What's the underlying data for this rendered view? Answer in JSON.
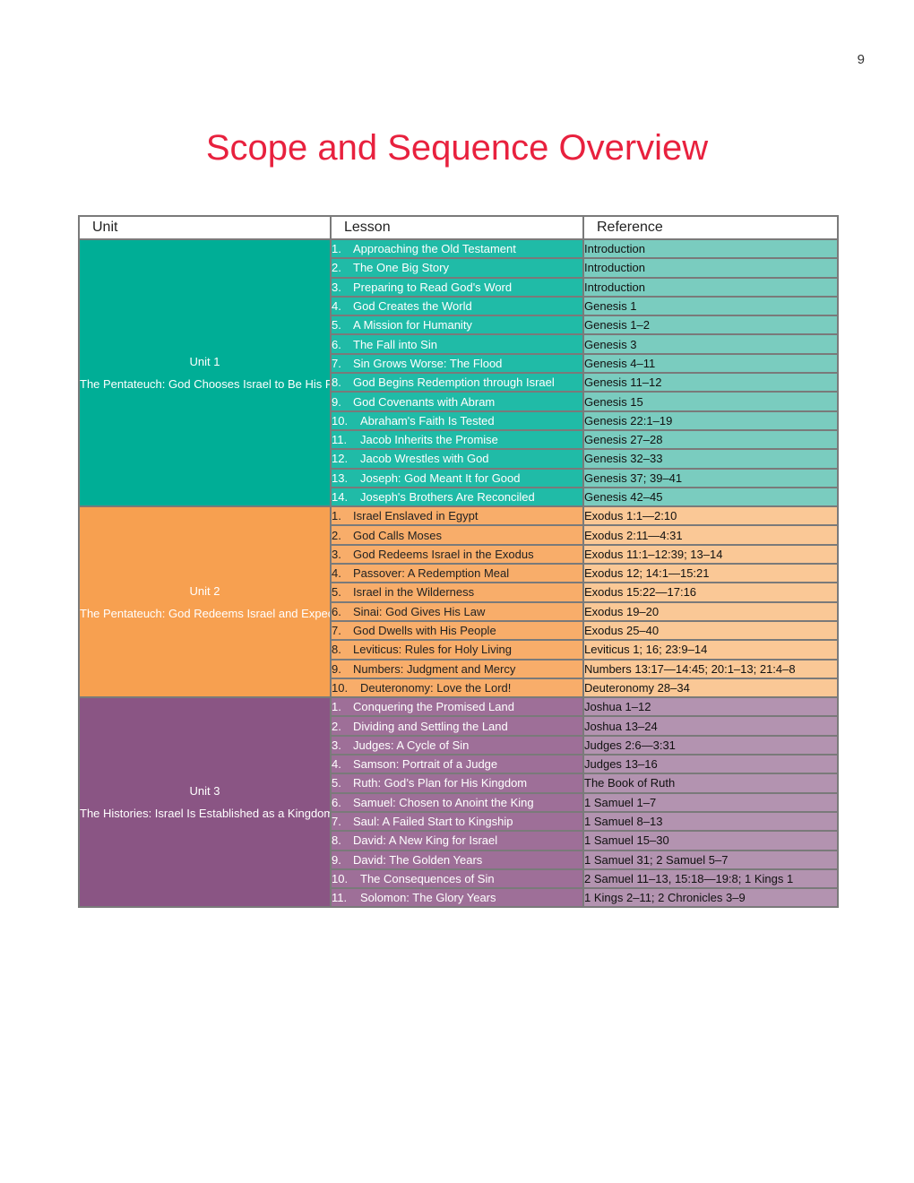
{
  "page_number": "9",
  "title": "Scope and Sequence Overview",
  "colors": {
    "title": "#e8213e",
    "unit1": {
      "unit": "#00ae96",
      "lesson": "#20bba7",
      "reference": "#7accbf"
    },
    "unit2": {
      "unit": "#f7a050",
      "lesson": "#f8ad6a",
      "reference": "#fac896"
    },
    "unit3": {
      "unit": "#8a5584",
      "lesson": "#9e6f98",
      "reference": "#b393b0"
    }
  },
  "table": {
    "headers": {
      "unit": "Unit",
      "lesson": "Lesson",
      "reference": "Reference"
    },
    "units": [
      {
        "label": "Unit 1",
        "name": "The Pentateuch: God Chooses Israel to Be His Redeemed People",
        "lessons": [
          {
            "num": "1.",
            "title": "Approaching the Old Testament",
            "reference": "Introduction"
          },
          {
            "num": "2.",
            "title": "The One Big Story",
            "reference": "Introduction"
          },
          {
            "num": "3.",
            "title": "Preparing to Read God's Word",
            "reference": "Introduction"
          },
          {
            "num": "4.",
            "title": "God Creates the World",
            "reference": "Genesis 1"
          },
          {
            "num": "5.",
            "title": "A Mission for Humanity",
            "reference": "Genesis 1–2"
          },
          {
            "num": "6.",
            "title": "The Fall into Sin",
            "reference": "Genesis 3"
          },
          {
            "num": "7.",
            "title": "Sin Grows Worse: The Flood",
            "reference": "Genesis 4–11"
          },
          {
            "num": "8.",
            "title": "God Begins Redemption through Israel",
            "reference": "Genesis 11–12"
          },
          {
            "num": "9.",
            "title": "God Covenants with Abram",
            "reference": "Genesis 15"
          },
          {
            "num": "10.",
            "title": "Abraham's Faith Is Tested",
            "reference": "Genesis 22:1–19"
          },
          {
            "num": "11.",
            "title": "Jacob Inherits the Promise",
            "reference": "Genesis 27–28"
          },
          {
            "num": "12.",
            "title": "Jacob Wrestles with God",
            "reference": "Genesis 32–33"
          },
          {
            "num": "13.",
            "title": "Joseph: God Meant It for Good",
            "reference": "Genesis 37; 39–41"
          },
          {
            "num": "14.",
            "title": "Joseph's Brothers Are Reconciled",
            "reference": "Genesis 42–45"
          }
        ]
      },
      {
        "label": "Unit 2",
        "name": "The Pentateuch: God Redeems Israel and Expects Covenant Loyalty",
        "lessons": [
          {
            "num": "1.",
            "title": "Israel Enslaved in Egypt",
            "reference": "Exodus 1:1—2:10"
          },
          {
            "num": "2.",
            "title": "God Calls Moses",
            "reference": "Exodus 2:11—4:31"
          },
          {
            "num": "3.",
            "title": "God Redeems Israel in the Exodus",
            "reference": "Exodus 11:1–12:39; 13–14"
          },
          {
            "num": "4.",
            "title": "Passover: A Redemption Meal",
            "reference": "Exodus 12; 14:1—15:21"
          },
          {
            "num": "5.",
            "title": "Israel in the Wilderness",
            "reference": "Exodus 15:22—17:16"
          },
          {
            "num": "6.",
            "title": "Sinai: God Gives His Law",
            "reference": "Exodus 19–20"
          },
          {
            "num": "7.",
            "title": "God Dwells with His People",
            "reference": "Exodus 25–40"
          },
          {
            "num": "8.",
            "title": "Leviticus: Rules for Holy Living",
            "reference": "Leviticus 1; 16; 23:9–14"
          },
          {
            "num": "9.",
            "title": "Numbers: Judgment and Mercy",
            "reference": "Numbers 13:17—14:45; 20:1–13; 21:4–8"
          },
          {
            "num": "10.",
            "title": "Deuteronomy: Love the Lord!",
            "reference": "Deuteronomy 28–34"
          }
        ]
      },
      {
        "label": "Unit 3",
        "name": "The Histories: Israel Is Established as a Kingdom",
        "lessons": [
          {
            "num": "1.",
            "title": "Conquering the Promised Land",
            "reference": "Joshua 1–12"
          },
          {
            "num": "2.",
            "title": "Dividing and Settling the Land",
            "reference": "Joshua 13–24"
          },
          {
            "num": "3.",
            "title": "Judges: A Cycle of Sin",
            "reference": "Judges 2:6—3:31"
          },
          {
            "num": "4.",
            "title": "Samson: Portrait of a Judge",
            "reference": "Judges 13–16"
          },
          {
            "num": "5.",
            "title": "Ruth: God’s Plan for His Kingdom",
            "reference": "The Book of Ruth"
          },
          {
            "num": "6.",
            "title": "Samuel: Chosen to Anoint the King",
            "reference": "1 Samuel 1–7"
          },
          {
            "num": "7.",
            "title": "Saul: A Failed Start to Kingship",
            "reference": "1 Samuel 8–13"
          },
          {
            "num": "8.",
            "title": "David: A New King for Israel",
            "reference": "1 Samuel 15–30"
          },
          {
            "num": "9.",
            "title": "David: The Golden Years",
            "reference": "1 Samuel 31; 2 Samuel 5–7"
          },
          {
            "num": "10.",
            "title": "The Consequences of Sin",
            "reference": "2 Samuel 11–13, 15:18—19:8; 1 Kings 1"
          },
          {
            "num": "11.",
            "title": "Solomon: The Glory Years",
            "reference": "1 Kings 2–11; 2 Chronicles 3–9"
          }
        ]
      }
    ]
  }
}
